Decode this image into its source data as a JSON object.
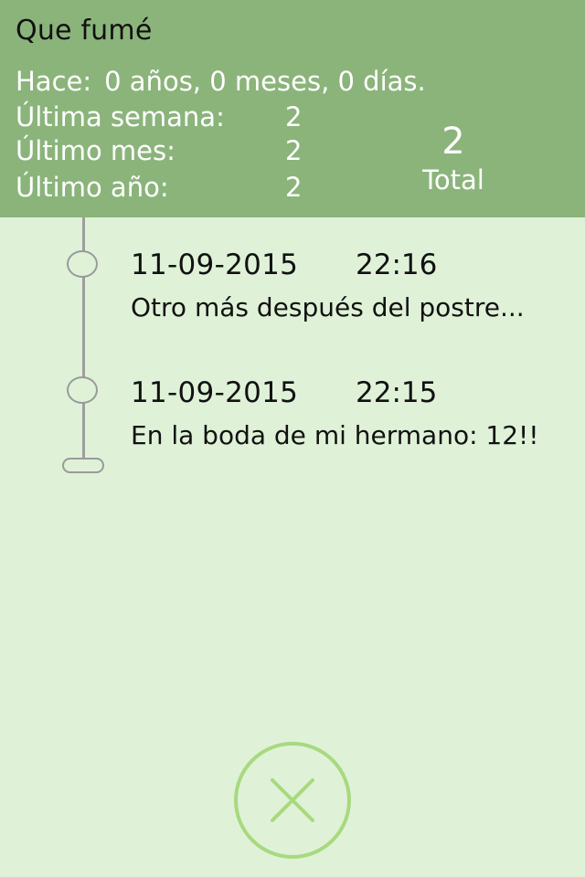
{
  "header": {
    "title": "Que fumé",
    "since_label": "Hace:",
    "since_value": "0 años, 0 meses, 0 días.",
    "stats": {
      "week_label": "Última semana:",
      "week_value": "2",
      "month_label": "Último mes:",
      "month_value": "2",
      "year_label": "Último año:",
      "year_value": "2"
    },
    "total_value": "2",
    "total_label": "Total"
  },
  "entries": [
    {
      "date": "11-09-2015",
      "time": "22:16",
      "note": "Otro más después del postre..."
    },
    {
      "date": "11-09-2015",
      "time": "22:15",
      "note": "En la boda de mi hermano: 12!!"
    }
  ],
  "close_button": {
    "icon": "close-icon"
  },
  "colors": {
    "header_bg": "#8bb47b",
    "body_bg": "#dff2d8",
    "accent": "#a8d97f",
    "timeline": "#9e9e9e"
  }
}
